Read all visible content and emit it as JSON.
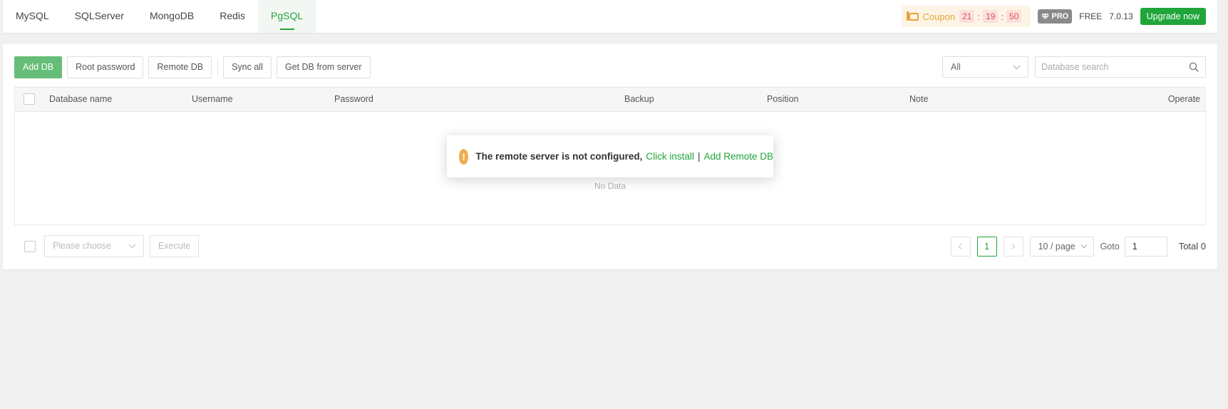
{
  "tabs": [
    {
      "label": "MySQL",
      "active": false
    },
    {
      "label": "SQLServer",
      "active": false
    },
    {
      "label": "MongoDB",
      "active": false
    },
    {
      "label": "Redis",
      "active": false
    },
    {
      "label": "PgSQL",
      "active": true
    }
  ],
  "header": {
    "coupon_label": "Coupon",
    "countdown": {
      "hours": "21",
      "minutes": "19",
      "seconds": "50"
    },
    "pro_badge": "PRO",
    "plan": "FREE",
    "version": "7.0.13",
    "upgrade_label": "Upgrade now"
  },
  "toolbar": {
    "add_db": "Add DB",
    "root_password": "Root password",
    "remote_db": "Remote DB",
    "sync_all": "Sync all",
    "get_db_from_server": "Get DB from server"
  },
  "filters": {
    "type_select": "All",
    "search_placeholder": "Database search"
  },
  "table": {
    "columns": [
      "Database name",
      "Username",
      "Password",
      "Backup",
      "Position",
      "Note",
      "Operate"
    ],
    "rows": [],
    "empty_text": "No Data"
  },
  "footer": {
    "batch_placeholder": "Please choose",
    "execute_label": "Execute",
    "current_page": "1",
    "page_size": "10 / page",
    "goto_label": "Goto",
    "goto_value": "1",
    "total": "Total 0"
  },
  "toast": {
    "message": "The remote server is not configured,",
    "link_install": "Click install",
    "separator": "|",
    "link_add_remote": "Add Remote DB"
  },
  "colors": {
    "accent": "#20a53a",
    "primary_button": "#66bd77",
    "warning": "#f0ad4e",
    "coupon_text": "#e8a23a"
  }
}
